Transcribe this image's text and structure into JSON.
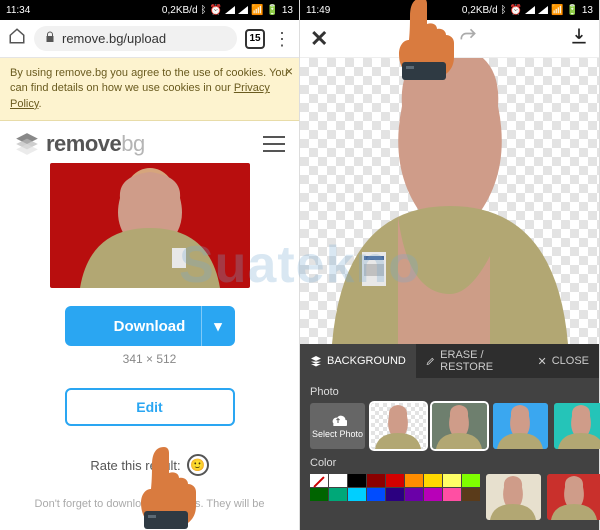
{
  "watermark": "Suatekno",
  "left": {
    "status": {
      "time": "11:34",
      "data_rate": "0,2KB/d",
      "battery": "13"
    },
    "browser": {
      "url": "remove.bg/upload",
      "tab_count": "15"
    },
    "cookie": {
      "text_a": "By using remove.bg you agree to the use of cookies. You can find details on how we use cookies in our ",
      "link": "Privacy Policy",
      "text_b": "."
    },
    "logo": {
      "part1": "remove",
      "part2": "bg"
    },
    "result": {
      "download_label": "Download",
      "dropdown_glyph": "▾",
      "dimensions": "341 × 512",
      "edit_label": "Edit",
      "rate_label": "Rate this result:"
    },
    "footnote": "Don't forget to download your files. They will be"
  },
  "right": {
    "status": {
      "time": "11:49",
      "data_rate": "0,2KB/d",
      "battery": "13"
    },
    "tabs": {
      "background": "BACKGROUND",
      "erase": "ERASE / RESTORE",
      "close": "CLOSE"
    },
    "panel": {
      "photo_label": "Photo",
      "upload_label": "Select Photo",
      "color_label": "Color",
      "thumb_bgs": [
        "checker",
        "#6e7f6e",
        "#3aa7f0",
        "#25c4b8",
        "#7bb56e"
      ],
      "color_thumb_bgs": [
        "#e7e0ce",
        "#c9302c"
      ],
      "swatches_row1": [
        "nocol",
        "#ffffff",
        "#000000",
        "#8b0000",
        "#d30000",
        "#ff8c00",
        "#ffd800",
        "#ffff66",
        "#7fff00"
      ],
      "swatches_row2": [
        "#006400",
        "#00a878",
        "#00cfff",
        "#004cff",
        "#2b0080",
        "#6a00a8",
        "#b800b8",
        "#ff4fa3",
        "#5a3b1a"
      ]
    }
  }
}
